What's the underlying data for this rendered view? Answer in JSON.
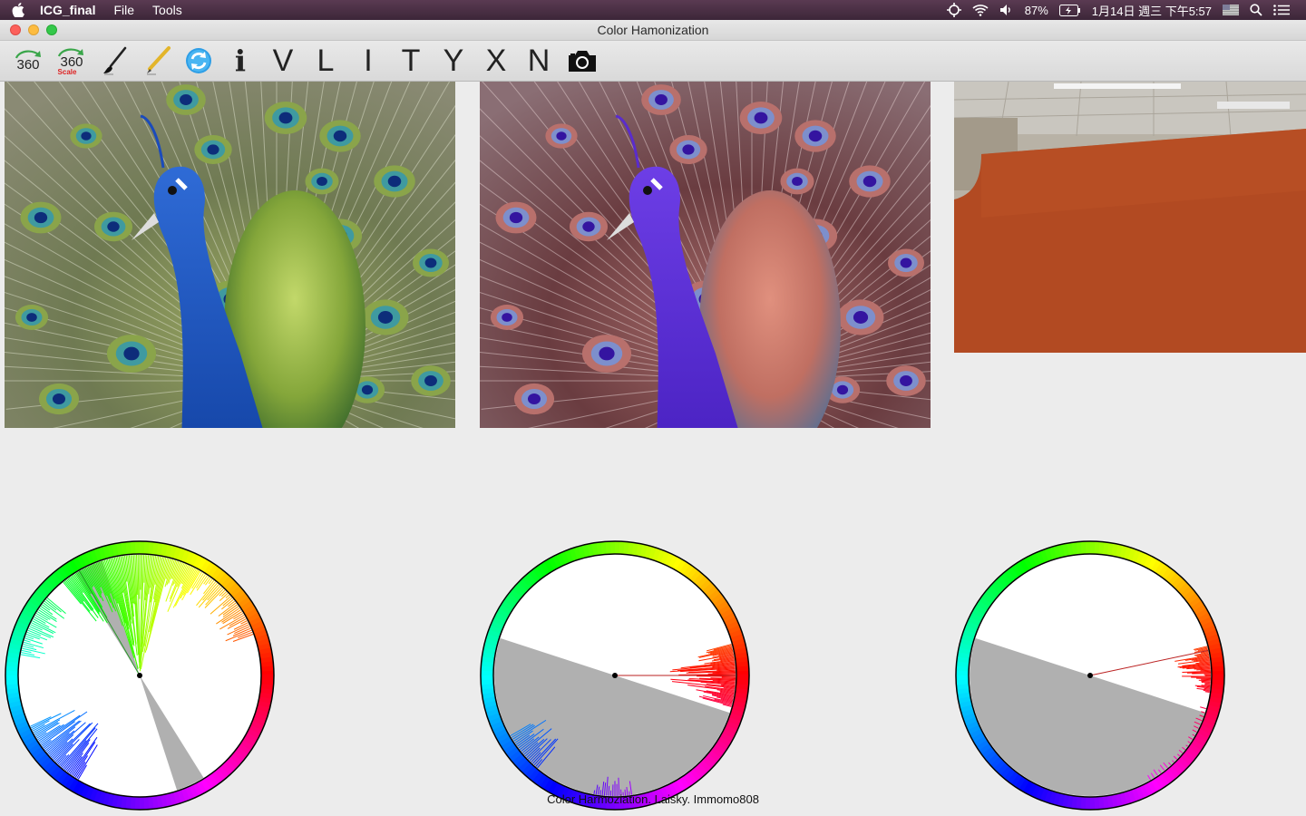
{
  "menubar": {
    "app_name": "ICG_final",
    "menus": [
      "File",
      "Tools"
    ],
    "status": {
      "battery": "87%",
      "datetime": "1月14日 週三 下午5:57"
    }
  },
  "window": {
    "title": "Color Hamonization"
  },
  "toolbar": {
    "rotate_label": "360",
    "scale_label": "360",
    "scale_sublabel": "Scale",
    "info_label": "i",
    "template_letters": [
      "V",
      "L",
      "I",
      "T",
      "Y",
      "X",
      "N"
    ]
  },
  "panels": {
    "original": "original-image",
    "harmonized": "harmonized-image",
    "camera": "camera-feed"
  },
  "wheels": [
    {
      "name": "original-hue-wheel",
      "sector_start_deg": 112,
      "sector_width_deg": 14,
      "dominant": "green"
    },
    {
      "name": "harmonized-hue-wheel",
      "sector_start_deg": -18,
      "sector_width_deg": 180,
      "dominant": "red"
    },
    {
      "name": "camera-hue-wheel",
      "sector_start_deg": -18,
      "sector_width_deg": 180,
      "dominant": "red"
    }
  ],
  "footer": {
    "credit": "Color Harmoziation. Laisky. Immomo808"
  },
  "colors": {
    "menubar": "#4a2f44",
    "background": "#ececec",
    "sector_gray": "#b0b0b0"
  }
}
